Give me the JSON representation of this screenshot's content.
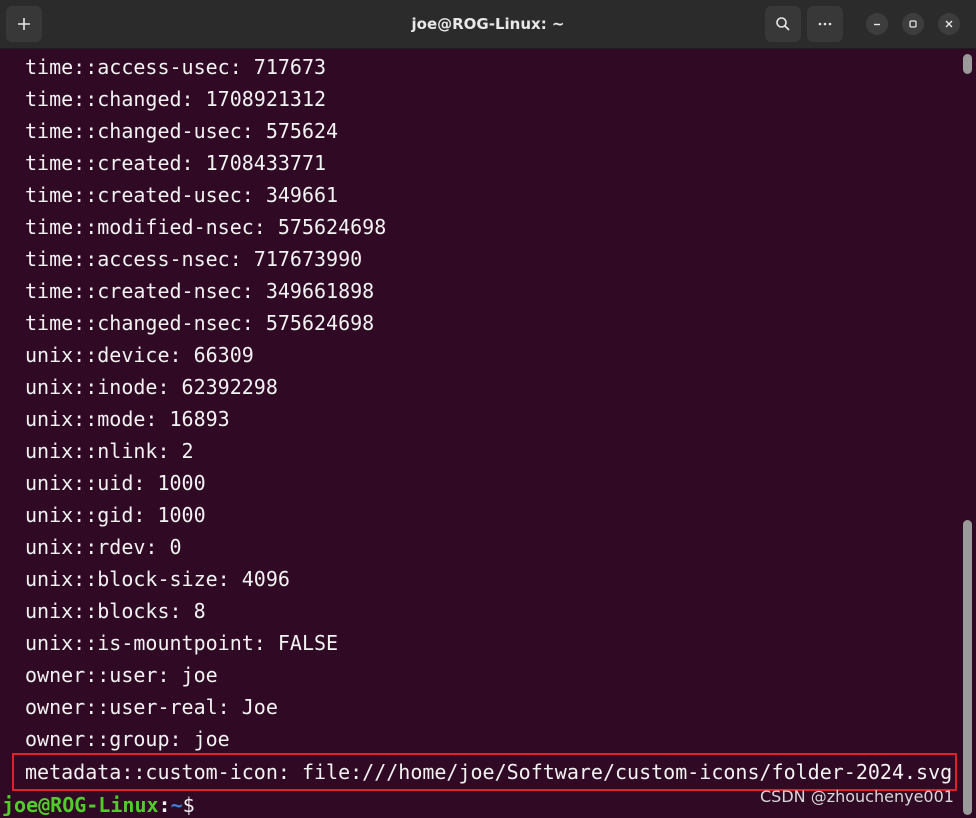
{
  "window": {
    "title": "joe@ROG-Linux: ~"
  },
  "toolbar": {
    "new_tab_icon": "plus-icon",
    "search_icon": "search-icon",
    "menu_icon": "ellipsis-icon",
    "minimize_icon": "minimize-icon",
    "maximize_icon": "maximize-icon",
    "close_icon": "close-icon"
  },
  "terminal": {
    "lines": [
      "time::access-usec: 717673",
      "time::changed: 1708921312",
      "time::changed-usec: 575624",
      "time::created: 1708433771",
      "time::created-usec: 349661",
      "time::modified-nsec: 575624698",
      "time::access-nsec: 717673990",
      "time::created-nsec: 349661898",
      "time::changed-nsec: 575624698",
      "unix::device: 66309",
      "unix::inode: 62392298",
      "unix::mode: 16893",
      "unix::nlink: 2",
      "unix::uid: 1000",
      "unix::gid: 1000",
      "unix::rdev: 0",
      "unix::block-size: 4096",
      "unix::blocks: 8",
      "unix::is-mountpoint: FALSE",
      "owner::user: joe",
      "owner::user-real: Joe",
      "owner::group: joe"
    ],
    "highlighted_line": "metadata::custom-icon: file:///home/joe/Software/custom-icons/folder-2024.svg",
    "prompt": {
      "user_host": "joe@ROG-Linux",
      "colon": ":",
      "path": "~",
      "symbol": "$"
    }
  },
  "watermark": "CSDN @zhouchenye001",
  "colors": {
    "background": "#300a24",
    "titlebar": "#2b2b2b",
    "prompt_user": "#4fce2a",
    "prompt_path": "#3f7fd8",
    "highlight_border": "#e0202a"
  }
}
